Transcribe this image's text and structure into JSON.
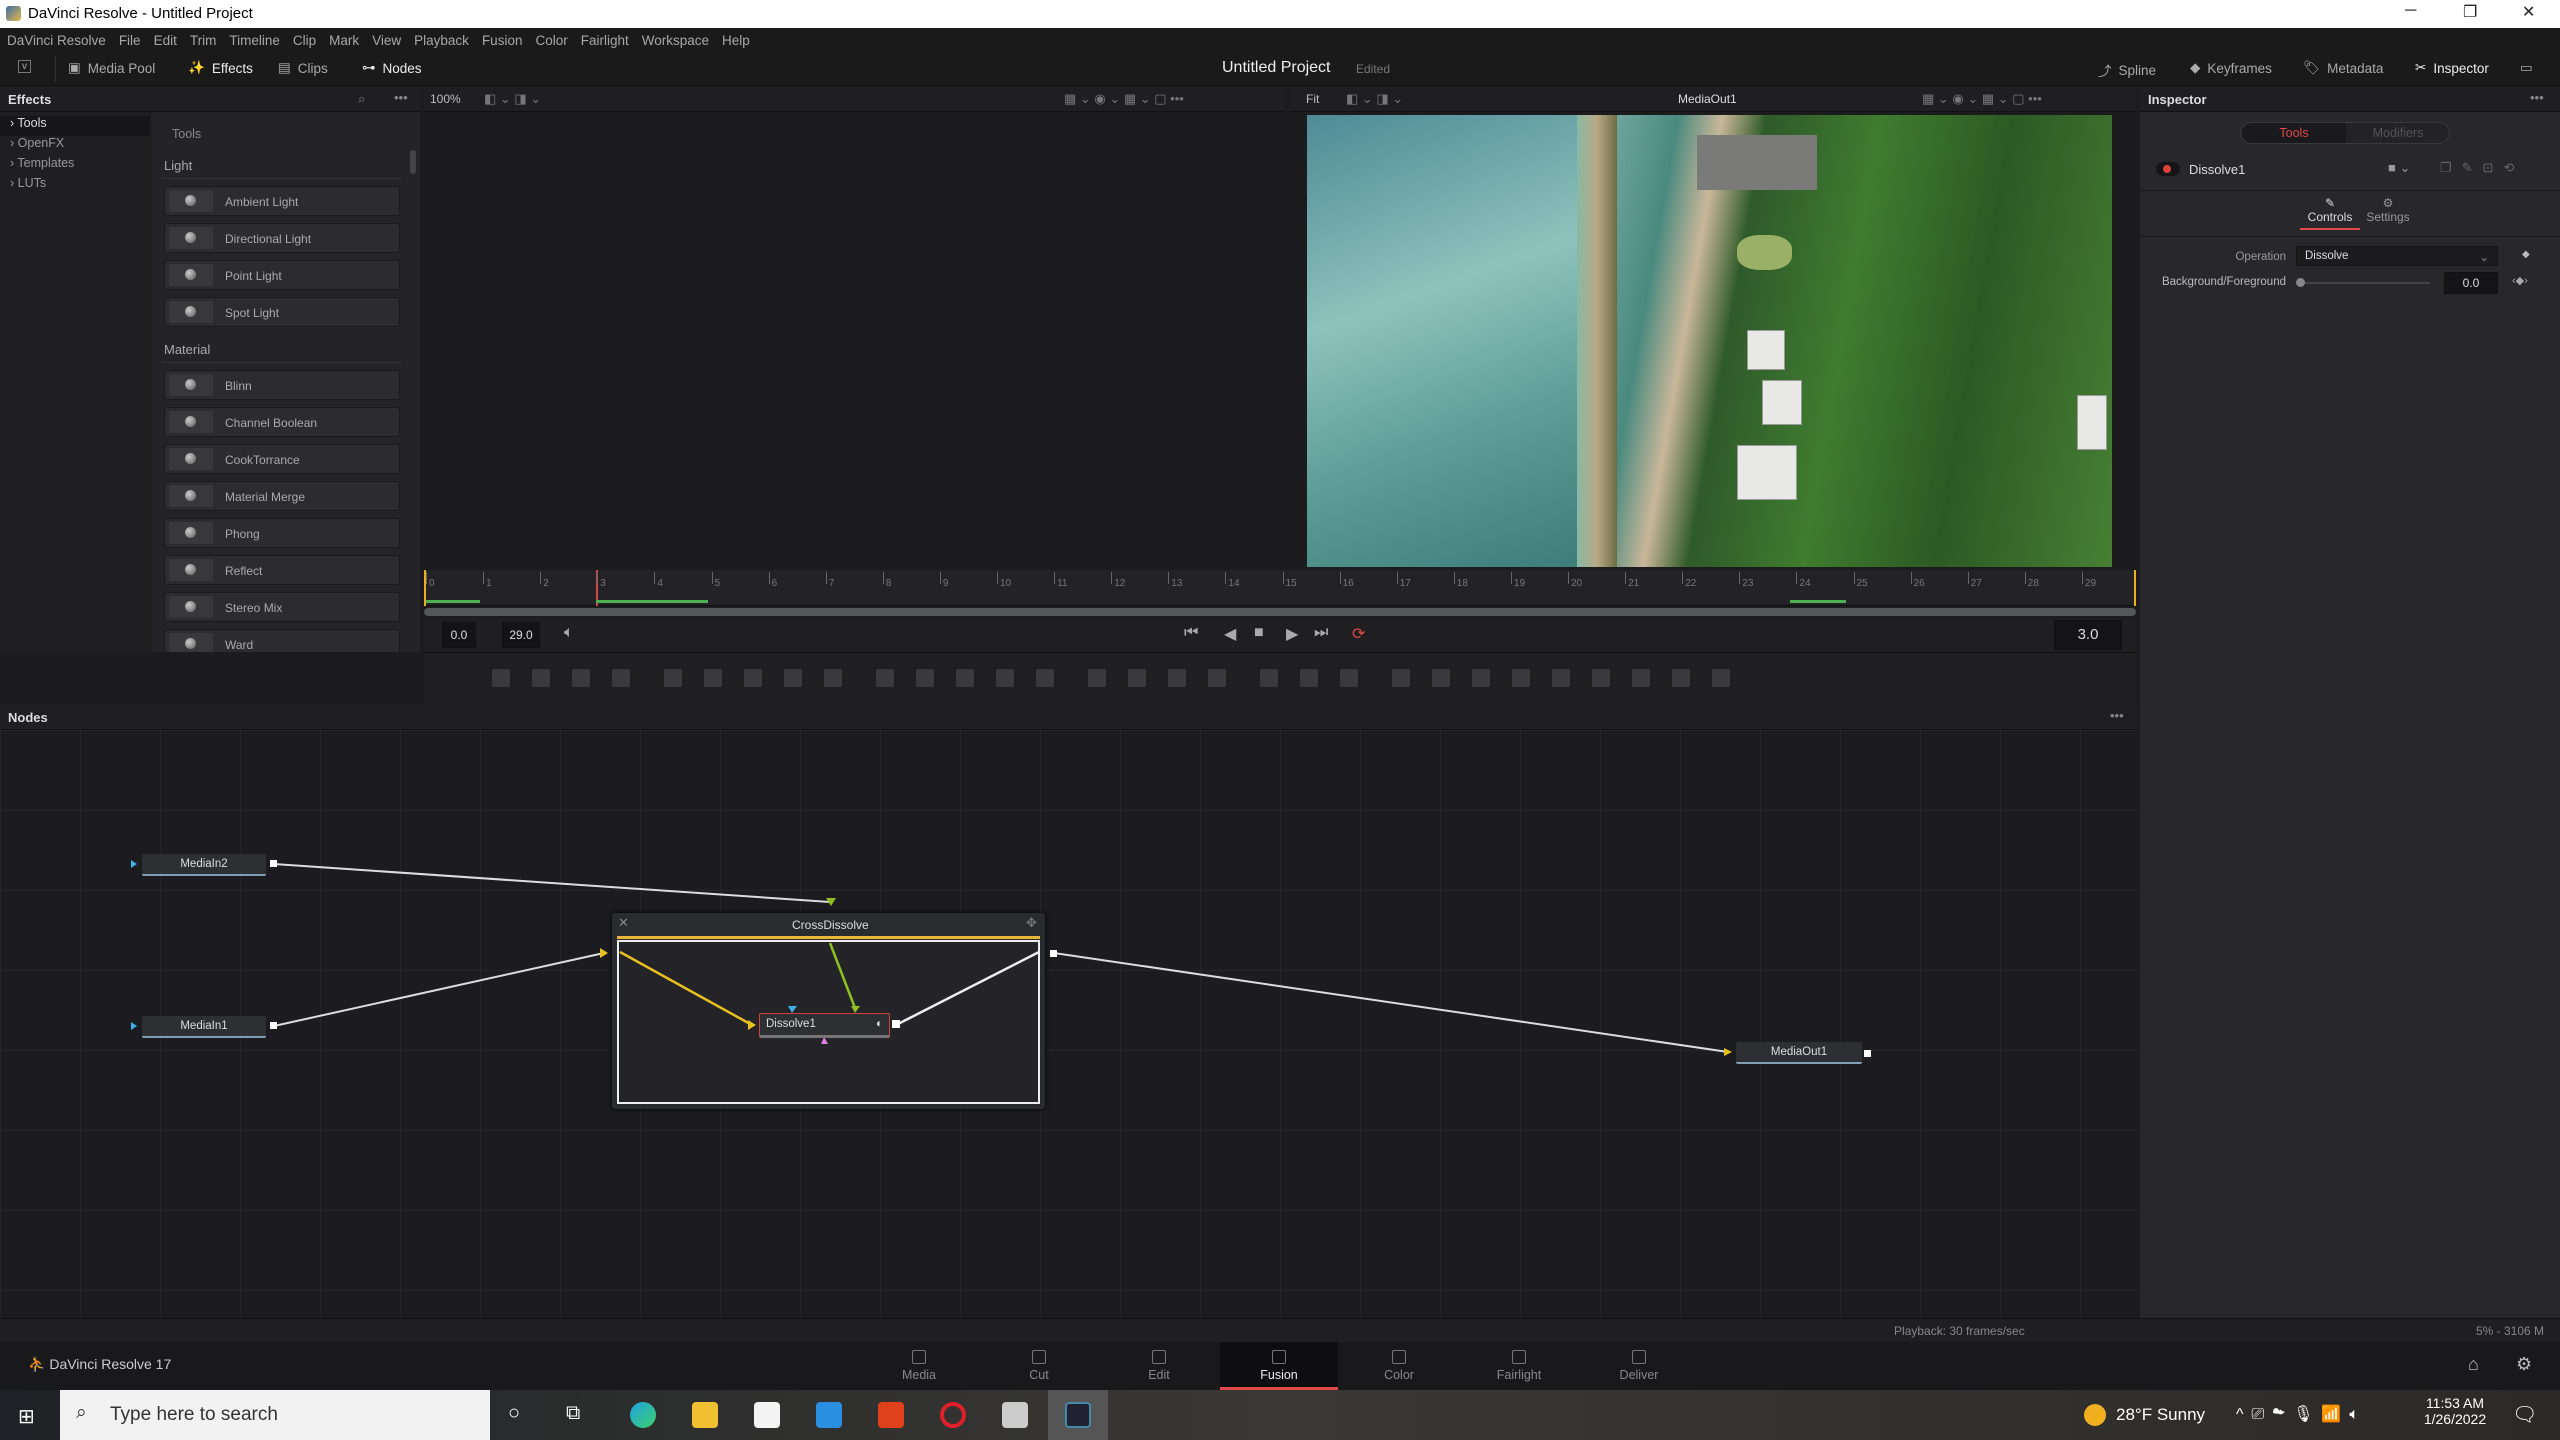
{
  "window": {
    "title": "DaVinci Resolve - Untitled Project"
  },
  "menu": [
    "DaVinci Resolve",
    "File",
    "Edit",
    "Trim",
    "Timeline",
    "Clip",
    "Mark",
    "View",
    "Playback",
    "Fusion",
    "Color",
    "Fairlight",
    "Workspace",
    "Help"
  ],
  "toolbar": {
    "media_pool": "Media Pool",
    "effects": "Effects",
    "clips": "Clips",
    "nodes": "Nodes",
    "project": "Untitled Project",
    "edited": "Edited",
    "spline": "Spline",
    "keyframes": "Keyframes",
    "metadata": "Metadata",
    "inspector": "Inspector"
  },
  "effects": {
    "title": "Effects",
    "categories": [
      "Tools",
      "OpenFX",
      "Templates",
      "LUTs"
    ],
    "header": "Tools",
    "sections": [
      {
        "name": "Light",
        "items": [
          "Ambient Light",
          "Directional Light",
          "Point Light",
          "Spot Light"
        ]
      },
      {
        "name": "Material",
        "items": [
          "Blinn",
          "Channel Boolean",
          "CookTorrance",
          "Material Merge",
          "Phong",
          "Reflect",
          "Stereo Mix",
          "Ward"
        ]
      }
    ]
  },
  "viewer": {
    "zoom_left": "100%",
    "zoom_right": "Fit",
    "right_title": "MediaOut1"
  },
  "timeline": {
    "ruler_start": 0,
    "ruler_end": 29,
    "start": "0.0",
    "end": "29.0",
    "current": "3.0"
  },
  "nodes": {
    "title": "Nodes",
    "mediain2": "MediaIn2",
    "mediain1": "MediaIn1",
    "group": "CrossDissolve",
    "dissolve": "Dissolve1",
    "mediaout": "MediaOut1"
  },
  "inspector": {
    "title": "Inspector",
    "tab_tools": "Tools",
    "tab_modifiers": "Modifiers",
    "node": "Dissolve1",
    "sub_controls": "Controls",
    "sub_settings": "Settings",
    "operation_label": "Operation",
    "operation_value": "Dissolve",
    "bgfg_label": "Background/Foreground",
    "bgfg_value": "0.0",
    "bgfg_fraction": 0.0
  },
  "status": {
    "playback": "Playback: 30 frames/sec",
    "memory": "5% - 3106 M"
  },
  "pages": {
    "app": "DaVinci Resolve 17",
    "tabs": [
      "Media",
      "Cut",
      "Edit",
      "Fusion",
      "Color",
      "Fairlight",
      "Deliver"
    ],
    "active": "Fusion"
  },
  "taskbar": {
    "search_placeholder": "Type here to search",
    "weather": "28°F  Sunny",
    "time": "11:53 AM",
    "date": "1/26/2022"
  },
  "colors": {
    "accent": "#e0484a",
    "yellow": "#e8c020",
    "green": "#8fbf20",
    "blue": "#3fb0e8",
    "pink": "#e080e0"
  }
}
